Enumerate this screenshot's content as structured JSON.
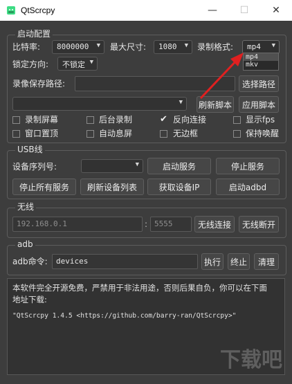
{
  "window": {
    "title": "QtScrcpy",
    "minimize": "—",
    "maximize": "☐",
    "close": "✕"
  },
  "config": {
    "group_title": "启动配置",
    "bitrate_label": "比特率:",
    "bitrate_value": "8000000",
    "maxsize_label": "最大尺寸:",
    "maxsize_value": "1080",
    "format_label": "录制格式:",
    "format_value": "mp4",
    "format_options": [
      "mp4",
      "mkv"
    ],
    "lock_label": "锁定方向:",
    "lock_value": "不锁定",
    "record_path_label": "录像保存路径:",
    "record_path_value": "",
    "select_path_button": "选择路径",
    "script_value": "",
    "refresh_script_button": "刷新脚本",
    "apply_script_button": "应用脚本",
    "checkboxes": [
      {
        "label": "录制屏幕",
        "checked": false
      },
      {
        "label": "后台录制",
        "checked": false
      },
      {
        "label": "反向连接",
        "checked": true
      },
      {
        "label": "显示fps",
        "checked": false
      },
      {
        "label": "窗口置顶",
        "checked": false
      },
      {
        "label": "自动息屏",
        "checked": false
      },
      {
        "label": "无边框",
        "checked": false
      },
      {
        "label": "保持唤醒",
        "checked": false
      }
    ]
  },
  "usb": {
    "group_title": "USB线",
    "serial_label": "设备序列号:",
    "serial_value": "",
    "start_service": "启动服务",
    "stop_service": "停止服务",
    "stop_all": "停止所有服务",
    "refresh_devices": "刷新设备列表",
    "get_ip": "获取设备IP",
    "start_adbd": "启动adbd"
  },
  "wireless": {
    "group_title": "无线",
    "ip_placeholder": "192.168.0.1",
    "colon": ":",
    "port_placeholder": "5555",
    "connect": "无线连接",
    "disconnect": "无线断开"
  },
  "adb": {
    "group_title": "adb",
    "cmd_label": "adb命令:",
    "cmd_value": "devices",
    "execute": "执行",
    "terminate": "终止",
    "clear": "清理"
  },
  "output": {
    "line1": "本软件完全开源免费，严禁用于非法用途，否则后果自负，你可以在下面",
    "line2": "地址下载:",
    "line3": "\"QtScrcpy 1.4.5 <https://github.com/barry-ran/QtScrcpy>\""
  },
  "watermark": {
    "text": "下载吧"
  },
  "colors": {
    "arrow": "#e02020",
    "background": "#3d3d3d"
  }
}
